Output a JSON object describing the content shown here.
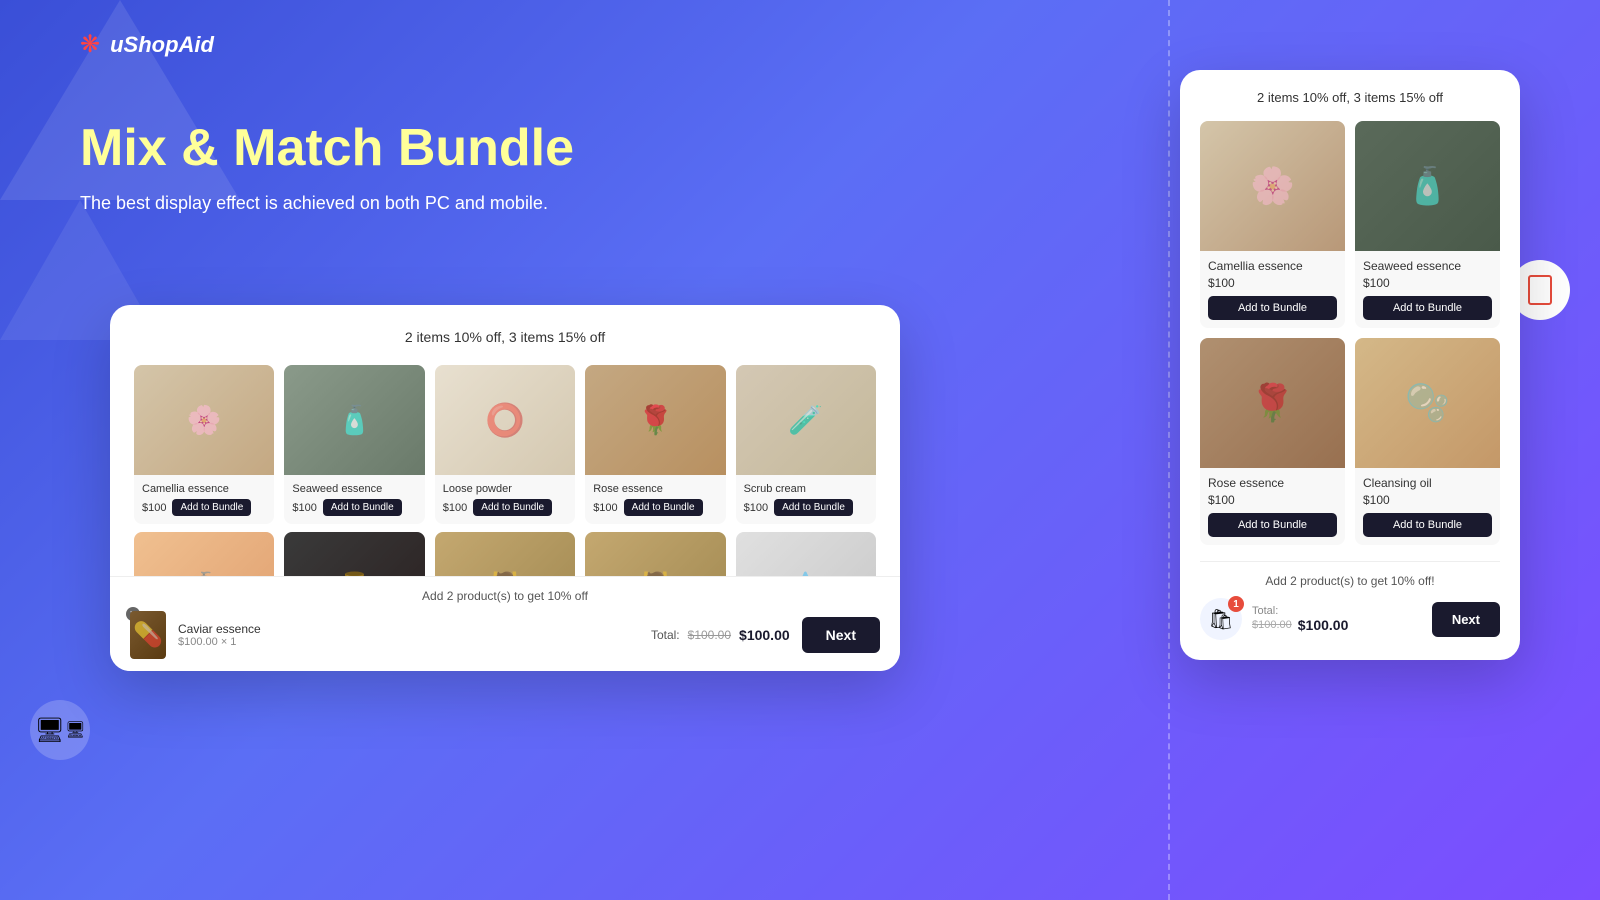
{
  "app": {
    "name": "uShopAid",
    "logo_symbol": "❋"
  },
  "hero": {
    "title": "Mix & Match Bundle",
    "subtitle": "The best display effect is achieved on both PC and mobile."
  },
  "pc_widget": {
    "discount_label": "2 items 10% off, 3 items 15% off",
    "products_row1": [
      {
        "name": "Camellia essence",
        "price": "$100",
        "btn_label": "Add to Bundle",
        "img_class": "img-camellia"
      },
      {
        "name": "Seaweed essence",
        "price": "$100",
        "btn_label": "Add to Bundle",
        "img_class": "img-seaweed"
      },
      {
        "name": "Loose powder",
        "price": "$100",
        "btn_label": "Add to Bundle",
        "img_class": "img-loose"
      },
      {
        "name": "Rose essence",
        "price": "$100",
        "btn_label": "Add to Bundle",
        "img_class": "img-rose"
      },
      {
        "name": "Scrub cream",
        "price": "$100",
        "btn_label": "Add to Bundle",
        "img_class": "img-scrub"
      }
    ],
    "products_row2": [
      {
        "img_class": "img-cream"
      },
      {
        "img_class": "img-dark-bottle"
      },
      {
        "img_class": "img-pump"
      },
      {
        "img_class": "img-pump"
      },
      {
        "img_class": "img-dropper"
      }
    ],
    "bottom_bar": {
      "add_message": "Add 2 product(s) to get 10% off",
      "cart_item": {
        "name": "Caviar essence",
        "price": "$100.00",
        "quantity": "× 1"
      },
      "total_label": "Total:",
      "total_old": "$100.00",
      "total_new": "$100.00",
      "next_btn": "Next"
    }
  },
  "mobile_widget": {
    "discount_label": "2 items 10% off, 3 items 15% off",
    "products": [
      {
        "name": "Camellia essence",
        "price": "$100",
        "btn_label": "Add to Bundle",
        "img_class": "mob-img-camellia"
      },
      {
        "name": "Seaweed essence",
        "price": "$100",
        "btn_label": "Add to Bundle",
        "img_class": "mob-img-seaweed"
      },
      {
        "name": "Rose essence",
        "price": "$100",
        "btn_label": "Add to Bundle",
        "img_class": "mob-img-rose"
      },
      {
        "name": "Cleansing oil",
        "price": "$100",
        "btn_label": "Add to Bundle",
        "img_class": "mob-img-cleansing"
      }
    ],
    "add_message": "Add 2 product(s) to get 10% off!",
    "cart_badge": "1",
    "total_label": "Total:",
    "total_old": "$100.00",
    "total_new": "$100.00",
    "next_btn": "Next"
  }
}
